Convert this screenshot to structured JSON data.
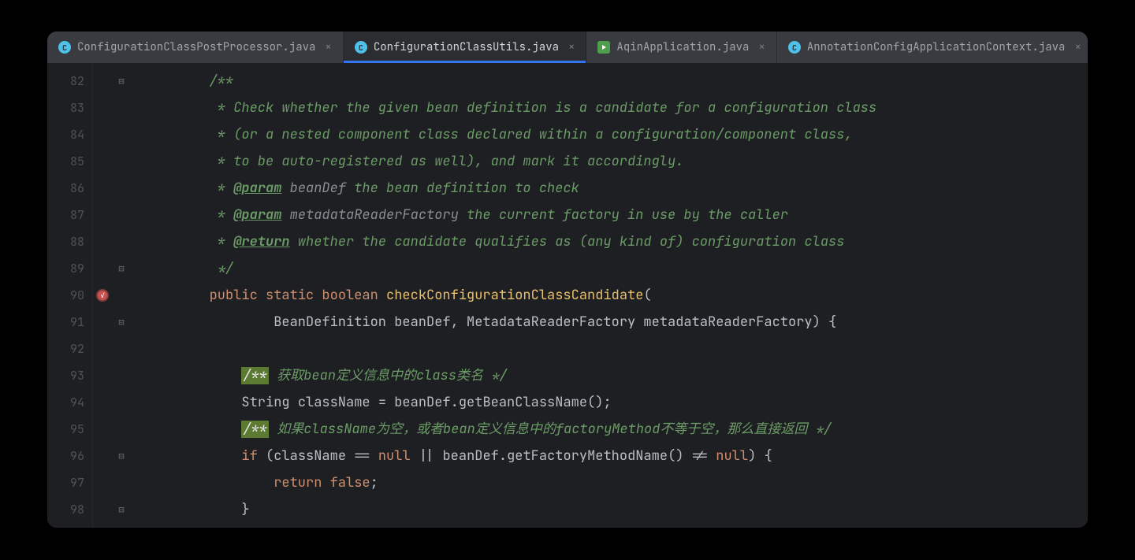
{
  "tabs": [
    {
      "label": "ConfigurationClassPostProcessor.java",
      "icon": "class-c",
      "active": false
    },
    {
      "label": "ConfigurationClassUtils.java",
      "icon": "class-c2",
      "active": true
    },
    {
      "label": "AqinApplication.java",
      "icon": "run",
      "active": false
    },
    {
      "label": "AnnotationConfigApplicationContext.java",
      "icon": "class-c",
      "active": false
    }
  ],
  "gutter": {
    "start": 82,
    "end": 98,
    "breakpoint_line": 90,
    "folds": {
      "82": "⊟",
      "89": "⊟",
      "91": "⊟",
      "96": "⊟",
      "98": "⊟"
    }
  },
  "code": {
    "82": {
      "indent": 2,
      "segs": [
        [
          "comment",
          "/**"
        ]
      ]
    },
    "83": {
      "indent": 2,
      "segs": [
        [
          "comment",
          " * Check whether the given bean definition is a candidate for a configuration class"
        ]
      ]
    },
    "84": {
      "indent": 2,
      "segs": [
        [
          "comment",
          " * (or a nested component class declared within a configuration/component class,"
        ]
      ]
    },
    "85": {
      "indent": 2,
      "segs": [
        [
          "comment",
          " * to be auto-registered as well), and mark it accordingly."
        ]
      ]
    },
    "86": {
      "indent": 2,
      "segs": [
        [
          "comment",
          " * "
        ],
        [
          "doctag",
          "@param"
        ],
        [
          "comment",
          " "
        ],
        [
          "doc-param-name",
          "beanDef"
        ],
        [
          "comment",
          " the bean definition to check"
        ]
      ]
    },
    "87": {
      "indent": 2,
      "segs": [
        [
          "comment",
          " * "
        ],
        [
          "doctag",
          "@param"
        ],
        [
          "comment",
          " "
        ],
        [
          "doc-param-name",
          "metadataReaderFactory"
        ],
        [
          "comment",
          " the current factory in use by the caller"
        ]
      ]
    },
    "88": {
      "indent": 2,
      "segs": [
        [
          "comment",
          " * "
        ],
        [
          "doctag",
          "@return"
        ],
        [
          "comment",
          " whether the candidate qualifies as (any kind of) configuration class"
        ]
      ]
    },
    "89": {
      "indent": 2,
      "segs": [
        [
          "comment",
          " */"
        ]
      ]
    },
    "90": {
      "indent": 2,
      "segs": [
        [
          "keyword",
          "public "
        ],
        [
          "keyword",
          "static "
        ],
        [
          "keyword",
          "boolean "
        ],
        [
          "method",
          "checkConfigurationClassCandidate"
        ],
        [
          "punct",
          "("
        ]
      ]
    },
    "91": {
      "indent": 4,
      "segs": [
        [
          "type",
          "BeanDefinition "
        ],
        [
          "type",
          "beanDef"
        ],
        [
          "punct",
          ", "
        ],
        [
          "type",
          "MetadataReaderFactory "
        ],
        [
          "type",
          "metadataReaderFactory"
        ],
        [
          "punct",
          ") "
        ],
        [
          "brace",
          "{"
        ]
      ]
    },
    "92": {
      "indent": 0,
      "segs": []
    },
    "93": {
      "indent": 3,
      "segs": [
        [
          "docstart",
          "/**"
        ],
        [
          "comment-zh",
          " 获取bean定义信息中的class类名 */"
        ]
      ]
    },
    "94": {
      "indent": 3,
      "segs": [
        [
          "type",
          "String "
        ],
        [
          "type",
          "className"
        ],
        [
          "punct",
          " = "
        ],
        [
          "type",
          "beanDef"
        ],
        [
          "punct",
          "."
        ],
        [
          "methodcall",
          "getBeanClassName"
        ],
        [
          "punct",
          "();"
        ]
      ]
    },
    "95": {
      "indent": 3,
      "segs": [
        [
          "docstart",
          "/**"
        ],
        [
          "comment-zh",
          " 如果className为空，或者bean定义信息中的factoryMethod不等于空，那么直接返回 */"
        ]
      ]
    },
    "96": {
      "indent": 3,
      "segs": [
        [
          "keyword",
          "if "
        ],
        [
          "punct",
          "("
        ],
        [
          "type",
          "className"
        ],
        [
          "punct",
          " == "
        ],
        [
          "lit",
          "null"
        ],
        [
          "punct",
          " "
        ],
        [
          "pipe",
          "||"
        ],
        [
          "punct",
          " "
        ],
        [
          "type",
          "beanDef"
        ],
        [
          "punct",
          "."
        ],
        [
          "methodcall",
          "getFactoryMethodName"
        ],
        [
          "punct",
          "() != "
        ],
        [
          "lit",
          "null"
        ],
        [
          "punct",
          ") "
        ],
        [
          "brace",
          "{"
        ]
      ]
    },
    "97": {
      "indent": 4,
      "segs": [
        [
          "keyword",
          "return "
        ],
        [
          "lit",
          "false"
        ],
        [
          "punct",
          ";"
        ]
      ]
    },
    "98": {
      "indent": 3,
      "segs": [
        [
          "brace",
          "}"
        ]
      ]
    }
  }
}
